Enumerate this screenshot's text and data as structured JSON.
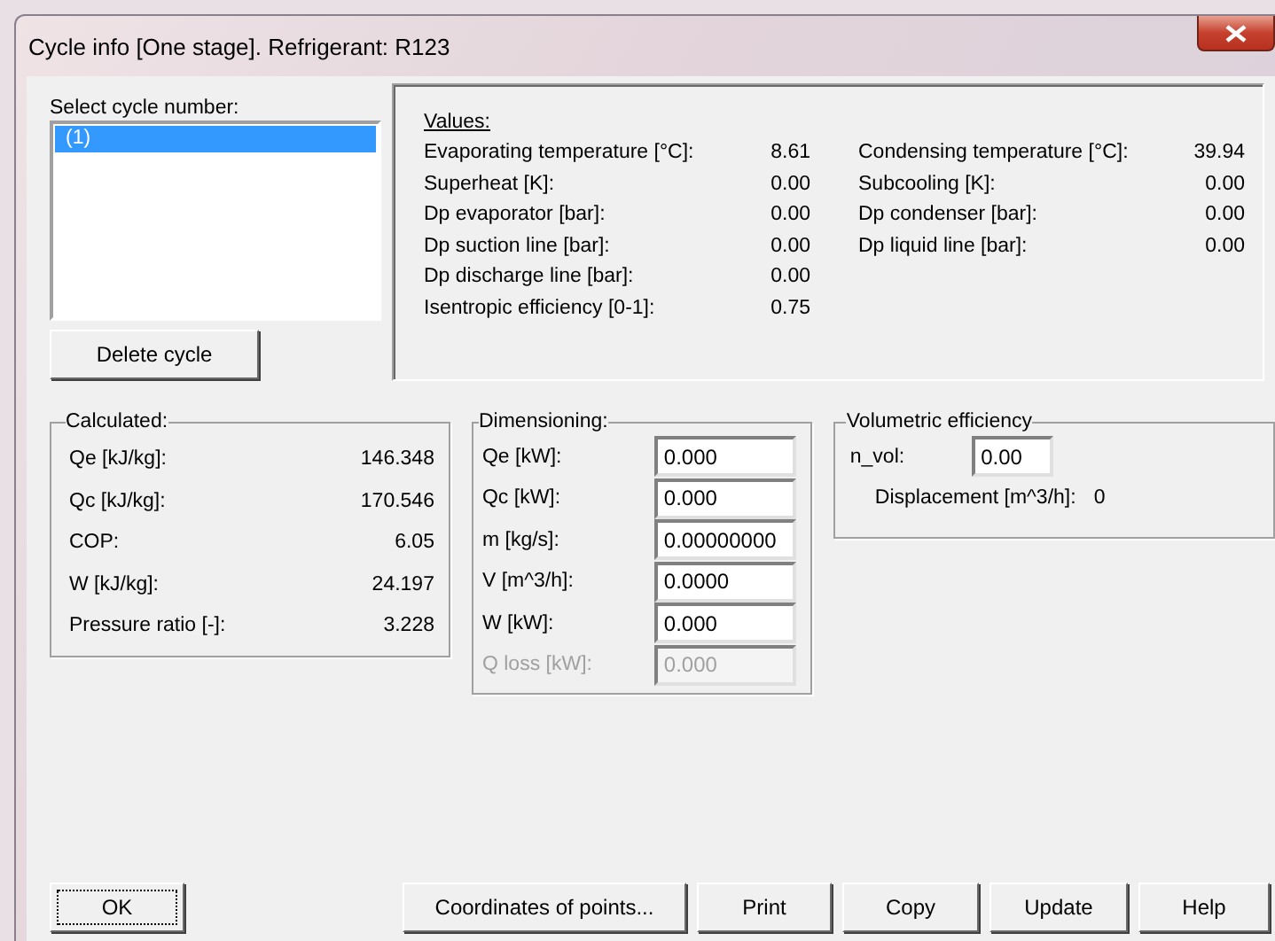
{
  "window": {
    "title": "Cycle info [One stage]. Refrigerant: R123"
  },
  "cycle_list": {
    "label": "Select cycle number:",
    "items": [
      {
        "text": "(1)",
        "selected": true
      }
    ],
    "delete_button": "Delete cycle"
  },
  "values": {
    "title": "Values:",
    "left": [
      {
        "label": "Evaporating temperature [°C]:",
        "value": "8.61"
      },
      {
        "label": "Superheat [K]:",
        "value": "0.00"
      },
      {
        "label": "Dp evaporator [bar]:",
        "value": "0.00"
      },
      {
        "label": "Dp suction line [bar]:",
        "value": "0.00"
      },
      {
        "label": "Dp discharge line [bar]:",
        "value": "0.00"
      },
      {
        "label": "Isentropic efficiency [0-1]:",
        "value": "0.75"
      }
    ],
    "right": [
      {
        "label": "Condensing temperature [°C]:",
        "value": "39.94"
      },
      {
        "label": "Subcooling [K]:",
        "value": "0.00"
      },
      {
        "label": "Dp condenser [bar]:",
        "value": "0.00"
      },
      {
        "label": "Dp liquid line [bar]:",
        "value": "0.00"
      }
    ]
  },
  "calculated": {
    "title": "Calculated:",
    "rows": [
      {
        "label": "Qe [kJ/kg]:",
        "value": "146.348"
      },
      {
        "label": "Qc [kJ/kg]:",
        "value": "170.546"
      },
      {
        "label": "COP:",
        "value": "6.05"
      },
      {
        "label": "W [kJ/kg]:",
        "value": "24.197"
      },
      {
        "label": "Pressure ratio [-]:",
        "value": "3.228"
      }
    ]
  },
  "dimensioning": {
    "title": "Dimensioning:",
    "fields": [
      {
        "label": "Qe [kW]:",
        "value": "0.000",
        "disabled": false
      },
      {
        "label": "Qc [kW]:",
        "value": "0.000",
        "disabled": false
      },
      {
        "label": "m [kg/s]:",
        "value": "0.00000000",
        "disabled": false
      },
      {
        "label": "V [m^3/h]:",
        "value": "0.0000",
        "disabled": false
      },
      {
        "label": "W [kW]:",
        "value": "0.000",
        "disabled": false
      },
      {
        "label": "Q loss [kW]:",
        "value": "0.000",
        "disabled": true
      }
    ]
  },
  "volumetric": {
    "title": "Volumetric efficiency",
    "n_vol": {
      "label": "n_vol:",
      "value": "0.00"
    },
    "displacement": {
      "label": "Displacement [m^3/h]:",
      "value": "0"
    }
  },
  "buttons": [
    {
      "kind": "left",
      "label": "OK",
      "focused": true
    },
    {
      "kind": "right",
      "label": "Coordinates of points...",
      "focused": false
    },
    {
      "kind": "right",
      "label": "Print",
      "focused": false
    },
    {
      "kind": "right",
      "label": "Copy",
      "focused": false
    },
    {
      "kind": "right",
      "label": "Update",
      "focused": false
    },
    {
      "kind": "right",
      "label": "Help",
      "focused": false
    }
  ]
}
